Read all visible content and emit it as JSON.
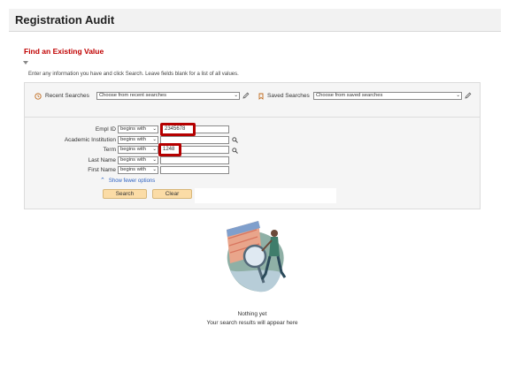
{
  "header": {
    "title": "Registration Audit"
  },
  "section": {
    "title": "Find an Existing Value",
    "instructions": "Enter any information you have and click Search. Leave fields blank for a list of all values."
  },
  "recent": {
    "label": "Recent Searches",
    "select_value": "Choose from recent searches",
    "icon": "clock-icon"
  },
  "saved": {
    "label": "Saved Searches",
    "select_value": "Choose from saved searches",
    "icon": "bookmark-icon"
  },
  "fields": [
    {
      "label": "Empl ID",
      "operator": "begins with",
      "value": "2345678",
      "highlighted": true
    },
    {
      "label": "Academic Institution",
      "operator": "begins with",
      "value": "",
      "lookup": true
    },
    {
      "label": "Term",
      "operator": "begins with",
      "value": "1248",
      "highlighted": true,
      "lookup": true
    },
    {
      "label": "Last Name",
      "operator": "begins with",
      "value": ""
    },
    {
      "label": "First Name",
      "operator": "begins with",
      "value": ""
    }
  ],
  "show_fewer": "Show fewer options",
  "buttons": {
    "search": "Search",
    "clear": "Clear"
  },
  "empty_state": {
    "title": "Nothing yet",
    "subtitle": "Your search results will appear here"
  },
  "colors": {
    "accent_red": "#c00000",
    "highlight_box": "#b50000",
    "button_fill": "#fbdca6",
    "link_blue": "#2f63c2"
  }
}
